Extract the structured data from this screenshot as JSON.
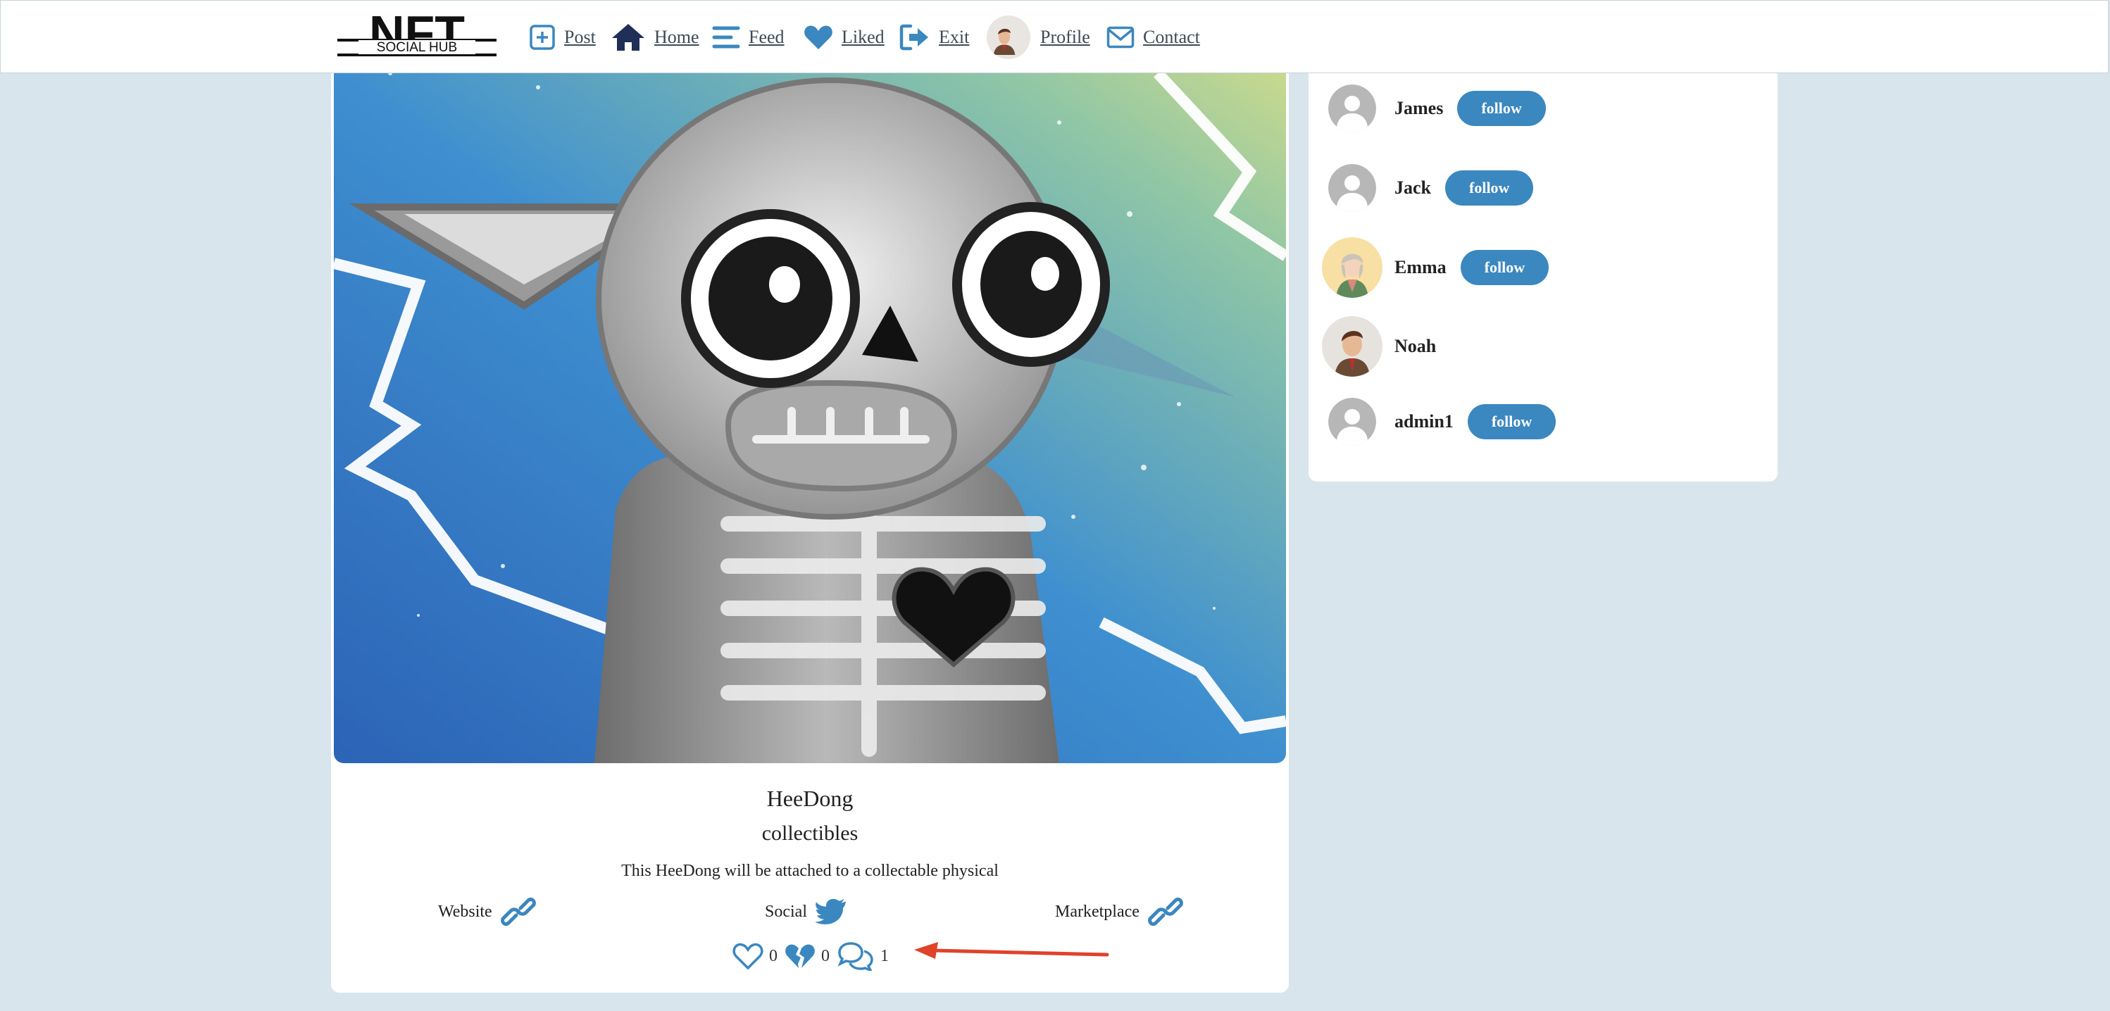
{
  "logo": {
    "top_text": "NFT",
    "bottom_text": "SOCIAL HUB"
  },
  "nav": {
    "items": [
      {
        "label": "Post",
        "icon": "plus-square-icon"
      },
      {
        "label": "Home",
        "icon": "home-icon"
      },
      {
        "label": "Feed",
        "icon": "feed-lines-icon"
      },
      {
        "label": "Liked",
        "icon": "heart-icon"
      },
      {
        "label": "Exit",
        "icon": "exit-icon"
      },
      {
        "label": "Profile",
        "icon": "avatar"
      },
      {
        "label": "Contact",
        "icon": "envelope-icon"
      }
    ]
  },
  "post": {
    "title": "HeeDong",
    "category": "collectibles",
    "description": "This HeeDong will be attached to a collectable physical",
    "links": {
      "website": "Website",
      "social": "Social",
      "marketplace": "Marketplace"
    },
    "stats": {
      "likes": "0",
      "dislikes": "0",
      "comments": "1"
    }
  },
  "suggestions": {
    "follow_label": "follow",
    "users": [
      {
        "name": "James",
        "avatar": "default-avatar",
        "show_follow": true
      },
      {
        "name": "Jack",
        "avatar": "default-avatar",
        "show_follow": true
      },
      {
        "name": "Emma",
        "avatar": "emma-avatar",
        "show_follow": true
      },
      {
        "name": "Noah",
        "avatar": "noah-avatar",
        "show_follow": false
      },
      {
        "name": "admin1",
        "avatar": "default-avatar",
        "show_follow": true
      }
    ]
  },
  "colors": {
    "accent": "#3b87bf",
    "background": "#d8e5ec",
    "nav_icon_blue": "#3b87bf",
    "home_icon": "#1f2f57",
    "annotation_arrow": "#e0422b"
  }
}
